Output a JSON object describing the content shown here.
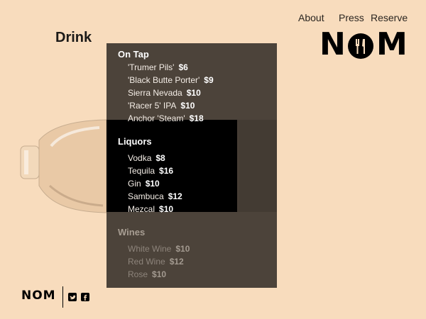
{
  "nav": {
    "about": "About",
    "press": "Press",
    "reserve": "Reserve"
  },
  "logo": {
    "text": "NOM"
  },
  "page": {
    "title": "Drink"
  },
  "menu": {
    "sections": [
      {
        "title": "On Tap",
        "items": [
          {
            "name": "'Trumer Pils'",
            "price": "$6"
          },
          {
            "name": "'Black Butte Porter'",
            "price": "$9"
          },
          {
            "name": "Sierra Nevada",
            "price": "$10"
          },
          {
            "name": "'Racer 5' IPA",
            "price": "$10"
          },
          {
            "name": "Anchor 'Steam'",
            "price": "$18"
          }
        ]
      },
      {
        "title": "Liquors",
        "items": [
          {
            "name": "Vodka",
            "price": "$8"
          },
          {
            "name": "Tequila",
            "price": "$16"
          },
          {
            "name": "Gin",
            "price": "$10"
          },
          {
            "name": "Sambuca",
            "price": "$12"
          },
          {
            "name": "Mezcal",
            "price": "$10"
          }
        ]
      },
      {
        "title": "Wines",
        "items": [
          {
            "name": "White Wine",
            "price": "$10"
          },
          {
            "name": "Red Wine",
            "price": "$12"
          },
          {
            "name": "Rose",
            "price": "$10"
          }
        ]
      }
    ]
  },
  "footer": {
    "logo_text": "NOM",
    "social": [
      "twitter-icon",
      "facebook-icon"
    ]
  },
  "colors": {
    "background": "#f8dcbd",
    "panel": "#453c34",
    "text_dark": "#1c1a18"
  }
}
